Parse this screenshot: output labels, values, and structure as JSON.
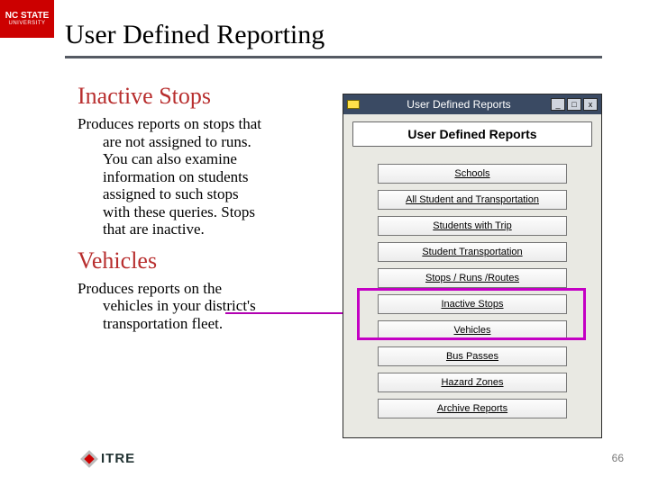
{
  "brand": {
    "name": "NC STATE",
    "sub": "UNIVERSITY"
  },
  "title": "User Defined Reporting",
  "sections": [
    {
      "heading": "Inactive Stops",
      "body": "Produces reports on stops that are not assigned to runs. You can also examine information on students assigned to such stops with these queries.  Stops that are inactive."
    },
    {
      "heading": "Vehicles",
      "body": "Produces reports on the vehicles in your district's transportation fleet."
    }
  ],
  "window": {
    "title": "User Defined Reports",
    "header": "User Defined Reports",
    "buttons": {
      "min": "_",
      "max": "□",
      "close": "x"
    },
    "items": [
      "Schools",
      "All Student and Transportation",
      "Students with Trip",
      "Student Transportation",
      "Stops / Runs /Routes",
      "Inactive Stops",
      "Vehicles",
      "Bus Passes",
      "Hazard Zones",
      "Archive Reports"
    ]
  },
  "footer": {
    "org": "ITRE",
    "page": "66"
  }
}
